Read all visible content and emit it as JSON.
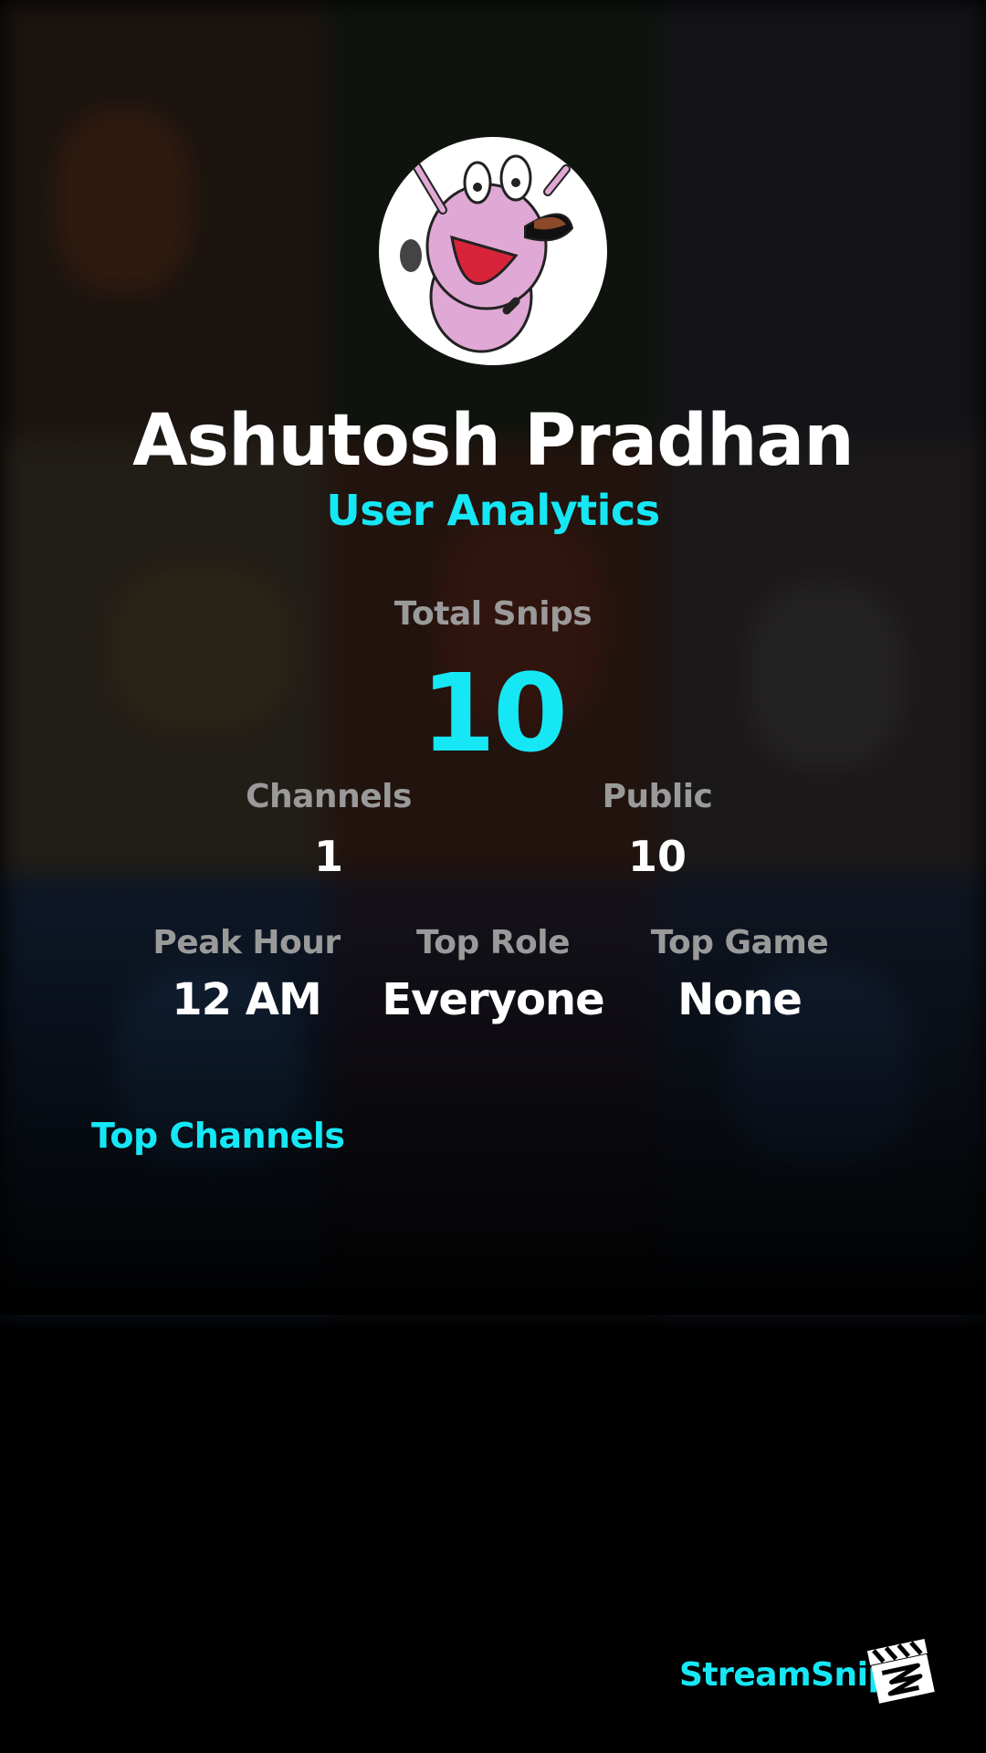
{
  "profile": {
    "name": "Ashutosh Pradhan",
    "subtitle": "User Analytics",
    "avatar_icon": "cartoon-dog-avatar"
  },
  "totals": {
    "label": "Total Snips",
    "value": "10"
  },
  "stats_row1": [
    {
      "label": "Channels",
      "value": "1"
    },
    {
      "label": "Public",
      "value": "10"
    }
  ],
  "stats_row2": [
    {
      "label": "Peak Hour",
      "value": "12 AM"
    },
    {
      "label": "Top Role",
      "value": "Everyone"
    },
    {
      "label": "Top Game",
      "value": "None"
    }
  ],
  "sections": {
    "top_channels": "Top Channels"
  },
  "footer": {
    "brand": "StreamSnip",
    "logo_icon": "clapperboard-icon"
  },
  "colors": {
    "accent": "#16e7f5",
    "background": "#000000",
    "label": "#9a9a9a",
    "text": "#ffffff"
  }
}
